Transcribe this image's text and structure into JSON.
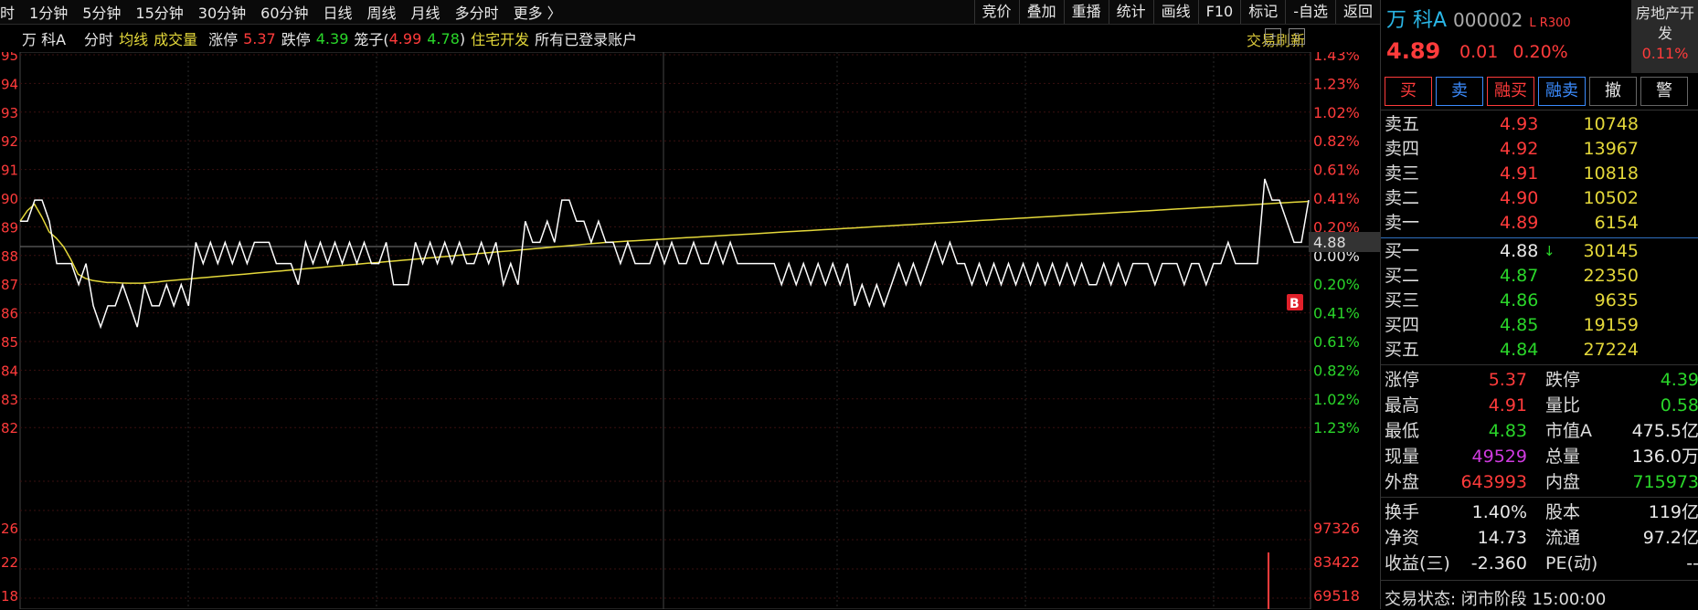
{
  "toolbar": {
    "left": [
      "时",
      "1分钟",
      "5分钟",
      "15分钟",
      "30分钟",
      "60分钟",
      "日线",
      "周线",
      "月线",
      "多分时",
      "更多 〉"
    ],
    "right": [
      "竞价",
      "叠加",
      "重播",
      "统计",
      "画线",
      "F10",
      "标记",
      "-自选",
      "返回"
    ]
  },
  "info": {
    "name": "万 科A",
    "view": "分时",
    "avg": "均线",
    "volume": "成交量",
    "limit_up_label": "涨停",
    "limit_up": "5.37",
    "limit_down_label": "跌停",
    "limit_down": "4.39",
    "cage_label": "笼子(",
    "cage_hi": "4.99",
    "cage_lo": "4.78",
    "cage_close": ")",
    "sector": "住宅开发",
    "accounts": "所有已登录账户",
    "refresh": "交易刷新"
  },
  "chart_data": {
    "type": "line",
    "title": "",
    "y_price_range": [
      4.77,
      4.96
    ],
    "left_tick_labels": [
      "95",
      "94",
      "93",
      "92",
      "91",
      "90",
      "89",
      "88",
      "87",
      "86",
      "85",
      "84",
      "83",
      "82"
    ],
    "right_tick_labels": [
      "1.43%",
      "1.23%",
      "1.02%",
      "0.82%",
      "0.61%",
      "0.41%",
      "0.20%",
      "0.00%",
      "0.20%",
      "0.41%",
      "0.61%",
      "0.82%",
      "1.02%",
      "1.23%"
    ],
    "volume_left_labels": [
      "26",
      "22",
      "18"
    ],
    "volume_right_labels": [
      "97326",
      "83422",
      "69518"
    ],
    "current_price_label": "4.88",
    "marker_label": "B",
    "series": [
      {
        "color": "#ffffff",
        "values": [
          4.88,
          4.88,
          4.89,
          4.89,
          4.88,
          4.86,
          4.86,
          4.86,
          4.85,
          4.86,
          4.84,
          4.83,
          4.84,
          4.84,
          4.85,
          4.84,
          4.83,
          4.85,
          4.84,
          4.84,
          4.85,
          4.84,
          4.85,
          4.84,
          4.87,
          4.86,
          4.87,
          4.86,
          4.87,
          4.86,
          4.87,
          4.86,
          4.87,
          4.87,
          4.87,
          4.86,
          4.86,
          4.86,
          4.85,
          4.87,
          4.86,
          4.87,
          4.86,
          4.87,
          4.86,
          4.87,
          4.86,
          4.87,
          4.86,
          4.86,
          4.87,
          4.85,
          4.85,
          4.85,
          4.87,
          4.86,
          4.87,
          4.86,
          4.87,
          4.86,
          4.87,
          4.86,
          4.86,
          4.87,
          4.86,
          4.87,
          4.85,
          4.86,
          4.85,
          4.88,
          4.87,
          4.87,
          4.88,
          4.87,
          4.89,
          4.89,
          4.88,
          4.88,
          4.87,
          4.88,
          4.87,
          4.87,
          4.86,
          4.87,
          4.86,
          4.86,
          4.86,
          4.87,
          4.86,
          4.87,
          4.86,
          4.86,
          4.87,
          4.86,
          4.86,
          4.87,
          4.86,
          4.87,
          4.86,
          4.86,
          4.86,
          4.86,
          4.86,
          4.86,
          4.85,
          4.86,
          4.85,
          4.86,
          4.85,
          4.86,
          4.85,
          4.86,
          4.85,
          4.86,
          4.84,
          4.85,
          4.84,
          4.85,
          4.84,
          4.85,
          4.86,
          4.85,
          4.86,
          4.85,
          4.86,
          4.87,
          4.86,
          4.87,
          4.86,
          4.86,
          4.85,
          4.86,
          4.85,
          4.86,
          4.85,
          4.86,
          4.85,
          4.86,
          4.85,
          4.86,
          4.85,
          4.86,
          4.85,
          4.86,
          4.85,
          4.86,
          4.85,
          4.85,
          4.86,
          4.85,
          4.86,
          4.85,
          4.86,
          4.86,
          4.86,
          4.85,
          4.86,
          4.86,
          4.86,
          4.85,
          4.86,
          4.86,
          4.85,
          4.86,
          4.86,
          4.87,
          4.86,
          4.86,
          4.86,
          4.86,
          4.9,
          4.89,
          4.89,
          4.88,
          4.87,
          4.87,
          4.89
        ]
      },
      {
        "color": "#e4d83a",
        "values": [
          4.88,
          4.885,
          4.888,
          4.882,
          4.875,
          4.872,
          4.868,
          4.862,
          4.855,
          4.853,
          4.852,
          4.8515,
          4.851,
          4.851,
          4.8508,
          4.8507,
          4.8507,
          4.8507,
          4.851,
          4.8513,
          4.8517,
          4.852,
          4.8523,
          4.8526,
          4.8529,
          4.8532,
          4.8535,
          4.8538,
          4.8541,
          4.8544,
          4.8547,
          4.855,
          4.8553,
          4.8556,
          4.8559,
          4.8562,
          4.8565,
          4.8568,
          4.8571,
          4.8574,
          4.8577,
          4.858,
          4.8583,
          4.8586,
          4.8589,
          4.8592,
          4.8595,
          4.8598,
          4.8601,
          4.8604,
          4.8607,
          4.861,
          4.8613,
          4.8616,
          4.8619,
          4.8622,
          4.8625,
          4.8628,
          4.8631,
          4.8634,
          4.8637,
          4.864,
          4.8643,
          4.8646,
          4.8649,
          4.8652,
          4.8655,
          4.8658,
          4.8661,
          4.8664,
          4.8667,
          4.867,
          4.8673,
          4.8676,
          4.8679,
          4.8682,
          4.8685,
          4.8688,
          4.8691,
          4.8694,
          4.8697,
          4.87,
          4.8702,
          4.8704,
          4.8706,
          4.8708,
          4.871,
          4.8712,
          4.8714,
          4.8716,
          4.8718,
          4.872,
          4.8722,
          4.8724,
          4.8726,
          4.8728,
          4.873,
          4.8732,
          4.8734,
          4.8736,
          4.8738,
          4.874,
          4.8742,
          4.8744,
          4.8746,
          4.8748,
          4.875,
          4.8752,
          4.8754,
          4.8756,
          4.8758,
          4.876,
          4.8762,
          4.8764,
          4.8766,
          4.8768,
          4.877,
          4.8772,
          4.8774,
          4.8776,
          4.8778,
          4.878,
          4.8782,
          4.8784,
          4.8786,
          4.8788,
          4.879,
          4.8792,
          4.8794,
          4.8796,
          4.8798,
          4.88,
          4.8802,
          4.8804,
          4.8806,
          4.8808,
          4.881,
          4.8812,
          4.8814,
          4.8816,
          4.8818,
          4.882,
          4.8822,
          4.8824,
          4.8826,
          4.8828,
          4.883,
          4.8832,
          4.8834,
          4.8836,
          4.8838,
          4.884,
          4.8842,
          4.8844,
          4.8846,
          4.8848,
          4.885,
          4.8852,
          4.8854,
          4.8856,
          4.8858,
          4.886,
          4.8862,
          4.8864,
          4.8866,
          4.8868,
          4.887,
          4.8872,
          4.8874,
          4.8876,
          4.8878,
          4.888,
          4.8882,
          4.8884,
          4.8886,
          4.8888,
          4.889,
          4.8892,
          4.8894
        ]
      }
    ]
  },
  "quote": {
    "name": "万 科A",
    "code": "000002",
    "marks": "L R300",
    "price": "4.89",
    "change": "0.01",
    "change_pct": "0.20%",
    "sector_tag": "房地产开发",
    "sector_pct": "0.11%"
  },
  "buttons": [
    "买",
    "卖",
    "融买",
    "融卖",
    "撤",
    "警"
  ],
  "asks": [
    {
      "label": "卖五",
      "price": "4.93",
      "vol": "10748"
    },
    {
      "label": "卖四",
      "price": "4.92",
      "vol": "13967"
    },
    {
      "label": "卖三",
      "price": "4.91",
      "vol": "10818"
    },
    {
      "label": "卖二",
      "price": "4.90",
      "vol": "10502"
    },
    {
      "label": "卖一",
      "price": "4.89",
      "vol": "6154"
    }
  ],
  "bids": [
    {
      "label": "买一",
      "price": "4.88",
      "vol": "30145",
      "arrow": "↓"
    },
    {
      "label": "买二",
      "price": "4.87",
      "vol": "22350",
      "arrow": ""
    },
    {
      "label": "买三",
      "price": "4.86",
      "vol": "9635",
      "arrow": ""
    },
    {
      "label": "买四",
      "price": "4.85",
      "vol": "19159",
      "arrow": ""
    },
    {
      "label": "买五",
      "price": "4.84",
      "vol": "27224",
      "arrow": ""
    }
  ],
  "stats": [
    {
      "l1": "涨停",
      "v1": "5.37",
      "c1": "red",
      "l2": "跌停",
      "v2": "4.39",
      "c2": "green"
    },
    {
      "l1": "最高",
      "v1": "4.91",
      "c1": "red",
      "l2": "量比",
      "v2": "0.58",
      "c2": "green"
    },
    {
      "l1": "最低",
      "v1": "4.83",
      "c1": "green",
      "l2": "市值A",
      "v2": "475.5亿",
      "c2": "white"
    },
    {
      "l1": "现量",
      "v1": "49529",
      "c1": "magenta",
      "l2": "总量",
      "v2": "136.0万",
      "c2": "white"
    },
    {
      "l1": "外盘",
      "v1": "643993",
      "c1": "red",
      "l2": "内盘",
      "v2": "715973",
      "c2": "green"
    }
  ],
  "stats2": [
    {
      "l1": "换手",
      "v1": "1.40%",
      "c1": "white",
      "l2": "股本",
      "v2": "119亿",
      "c2": "white"
    },
    {
      "l1": "净资",
      "v1": "14.73",
      "c1": "white",
      "l2": "流通",
      "v2": "97.2亿",
      "c2": "white"
    },
    {
      "l1": "收益(三)",
      "v1": "-2.360",
      "c1": "white",
      "l2": "PE(动)",
      "v2": "--",
      "c2": "white"
    }
  ],
  "status": "交易状态: 闭市阶段 15:00:00"
}
